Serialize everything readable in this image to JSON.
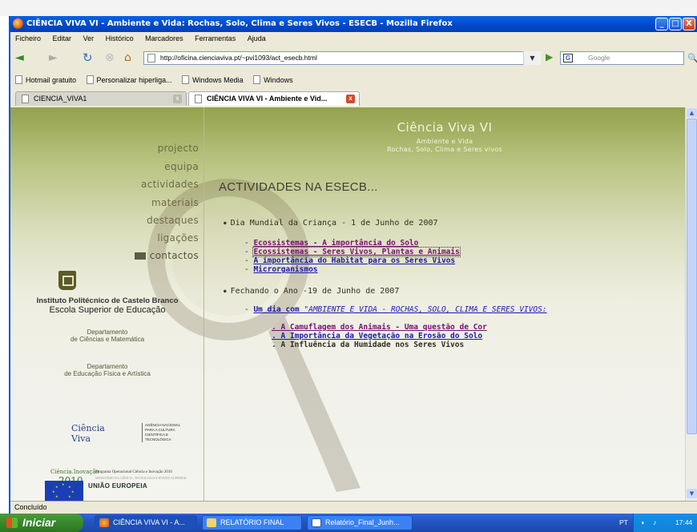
{
  "window": {
    "title": "CIÊNCIA VIVA VI - Ambiente e Vida: Rochas, Solo, Clima e Seres Vivos - ESECB - Mozilla Firefox",
    "minimize": "_",
    "maximize": "□",
    "close": "X"
  },
  "menubar": [
    "Ficheiro",
    "Editar",
    "Ver",
    "Histórico",
    "Marcadores",
    "Ferramentas",
    "Ajuda"
  ],
  "navigation": {
    "back_icon": "◄",
    "forward_icon": "►",
    "url": "http://oficina.cienciaviva.pt/~pvi1093/act_esecb.html",
    "search_placeholder": "Google",
    "search_engine_icon": "G"
  },
  "bookmarks": [
    "Hotmail gratuito",
    "Personalizar hiperliga...",
    "Windows Media",
    "Windows"
  ],
  "tabs": [
    {
      "label": "CIENCIA_VIVA1"
    },
    {
      "label": "CIÊNCIA VIVA VI - Ambiente e Vid..."
    }
  ],
  "sidebar": {
    "nav": [
      "projecto",
      "equipa",
      "actividades",
      "materiais",
      "destaques",
      "ligações",
      "contactos"
    ],
    "institution_line1": "Instituto Politécnico de Castelo Branco",
    "institution_line2": "Escola Superior de Educação",
    "dept1_line1": "Departamento",
    "dept1_line2": "de Ciências e Matemática",
    "dept2_line1": "Departamento",
    "dept2_line2": "de Educação Física e Artística",
    "logo_cv": "Ciência Viva",
    "logo_agencia": "AGÊNCIA NACIONAL PARA A CULTURA CIENTÍFICA E TECNOLÓGICA",
    "logo_ci_1": "Ciência.Inovação",
    "logo_ci_2": "2010",
    "logo_ci_3": "Programa Operacional Ciência e Inovação 2010",
    "logo_ci_4": "MINISTÉRIO DA CIÊNCIA, TECNOLOGIA E ENSINO SUPERIOR",
    "eu": "UNIÃO EUROPEIA"
  },
  "main": {
    "header_title": "Ciência Viva VI",
    "header_sub1": "Ambiente e Vida",
    "header_sub2": "Rochas, Solo, Clima e Seres vivos",
    "page_title": "ACTIVIDADES NA ESECB...",
    "section1": "Dia Mundial da Criança - 1 de Junho de 2007",
    "section1_links": [
      "Ecossistemas - A importância do Solo",
      "Ecossistemas - Seres Vivos, Plantas e Animais",
      "A importância do Habitat para os Seres Vivos",
      "Microrganismos"
    ],
    "section2": "Fechando o Ano -19 de Junho de 2007",
    "section2_intro_prefix": "Um dia com ",
    "section2_intro_italic": "\"AMBIENTE E VIDA - ROCHAS, SOLO, CLIMA E SERES VIVOS:",
    "section2_items": [
      ". A Camuflagem dos Animais - Uma questão de Cor",
      ". A Importância da Vegetação na Erosão do Solo",
      ". A Influência da Humidade nos Seres Vivos"
    ]
  },
  "status": "Concluído",
  "taskbar": {
    "start": "Iniciar",
    "buttons": [
      "CIÊNCIA VIVA VI - A...",
      "RELATÓRIO FINAL",
      "Relatório_Final_Junh..."
    ],
    "lang": "PT",
    "clock": "17:44"
  }
}
